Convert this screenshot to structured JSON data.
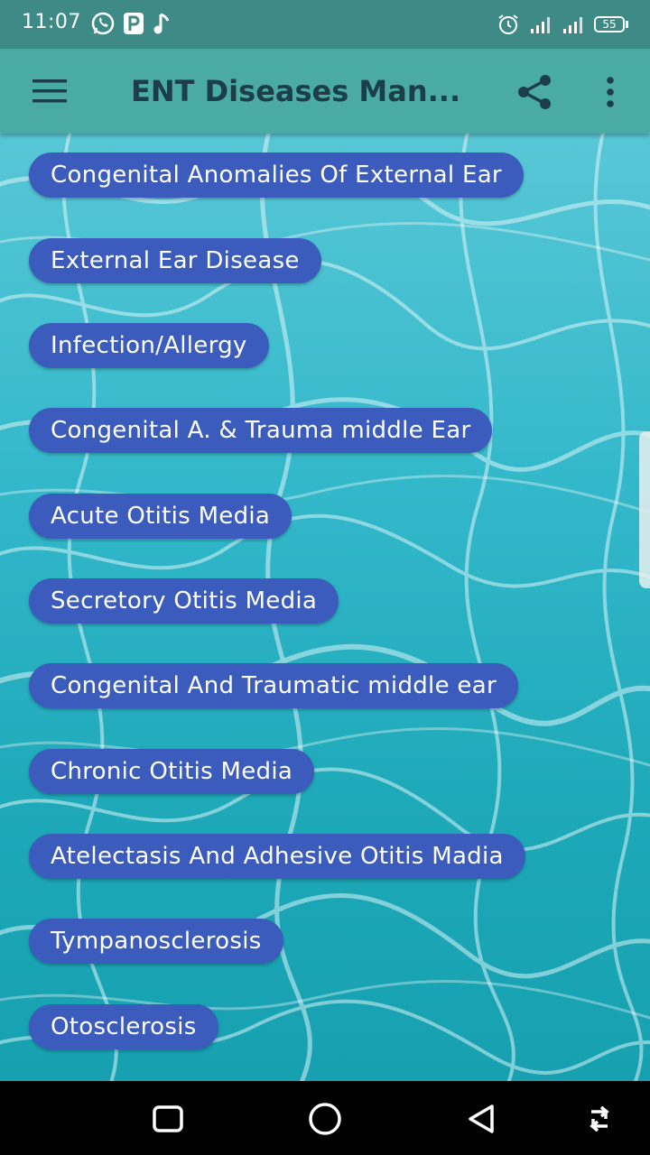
{
  "status_bar": {
    "time": "11:07",
    "battery_level": "55",
    "icons": [
      "whatsapp-icon",
      "p-app-icon",
      "music-note-icon",
      "alarm-icon",
      "signal-icon",
      "signal-icon-2",
      "battery-icon"
    ]
  },
  "app_bar": {
    "title": "ENT Diseases Man...",
    "color": "#4aaaa4",
    "icons": [
      "menu-icon",
      "share-icon",
      "more-vert-icon"
    ]
  },
  "topics": [
    "Congenital Anomalies Of External Ear",
    "External Ear Disease",
    "Infection/Allergy",
    "Congenital A. & Trauma middle Ear",
    "Acute Otitis Media",
    "Secretory Otitis Media",
    "Congenital And Traumatic middle ear",
    "Chronic Otitis Media",
    "Atelectasis And Adhesive Otitis Madia",
    "Tympanosclerosis",
    "Otosclerosis"
  ],
  "button_color": "#3b5cbc",
  "nav_bar": {
    "icons": [
      "recent-apps-icon",
      "home-icon",
      "back-icon",
      "rotate-icon"
    ]
  }
}
